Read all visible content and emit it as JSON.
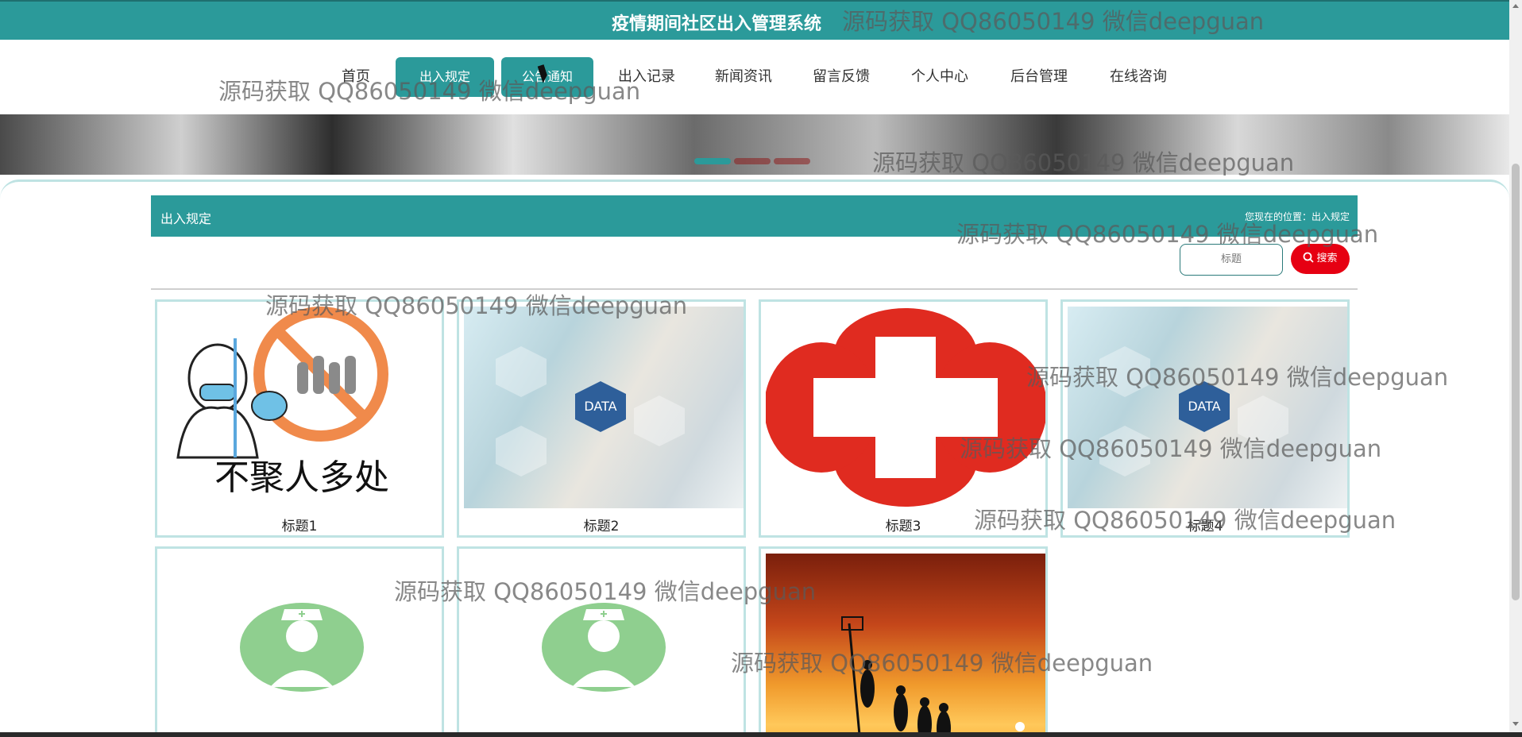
{
  "header": {
    "title": "疫情期间社区出入管理系统"
  },
  "nav": {
    "items": [
      "首页",
      "出入规定",
      "公告通知",
      "出入记录",
      "新闻资讯",
      "留言反馈",
      "个人中心",
      "后台管理",
      "在线咨询"
    ]
  },
  "section": {
    "title": "出入规定",
    "breadcrumb": "您现在的位置：出入规定"
  },
  "search": {
    "placeholder": "标题",
    "button": "搜索"
  },
  "cards": [
    {
      "title": "标题1",
      "image": "no-gathering-poster"
    },
    {
      "title": "标题2",
      "image": "medical-data-laptop"
    },
    {
      "title": "标题3",
      "image": "red-cross"
    },
    {
      "title": "标题4",
      "image": "medical-data-laptop"
    },
    {
      "title": "",
      "image": "doctor-avatar"
    },
    {
      "title": "",
      "image": "doctor-avatar"
    },
    {
      "title": "",
      "image": "basketball-sunset"
    }
  ],
  "watermark": "源码获取 QQ86050149 微信deepguan",
  "colors": {
    "primary": "#2b9a9a",
    "search_button": "#e60012"
  }
}
